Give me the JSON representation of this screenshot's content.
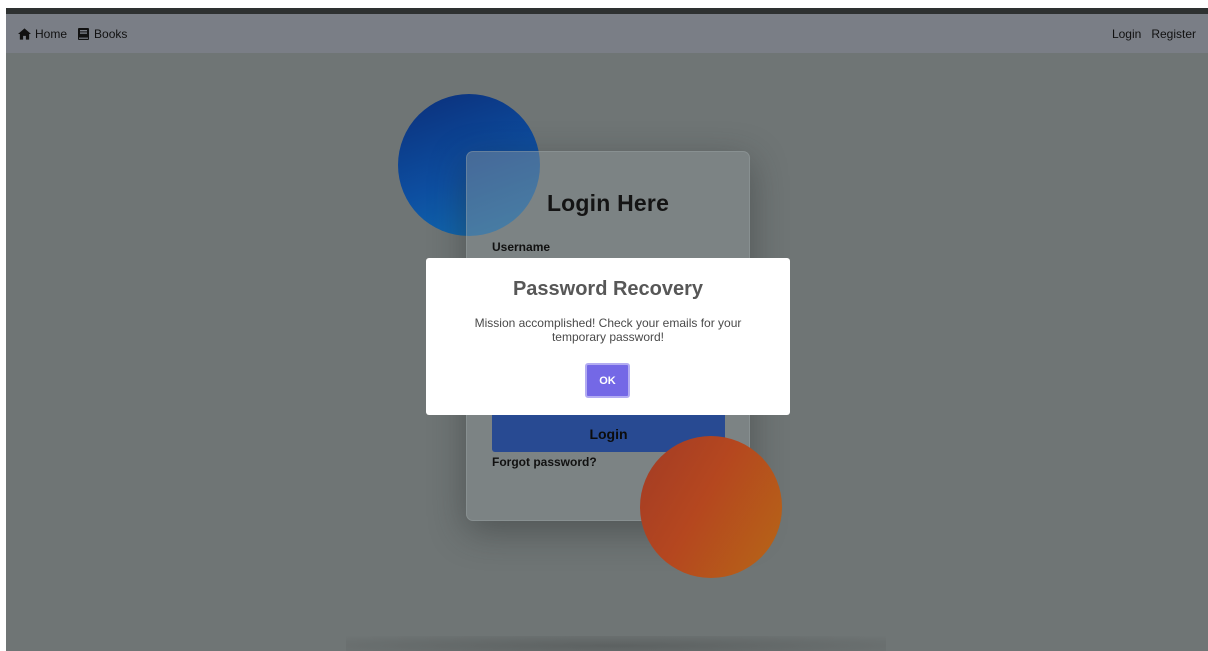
{
  "navbar": {
    "home_label": "Home",
    "books_label": "Books",
    "login_label": "Login",
    "register_label": "Register"
  },
  "login_form": {
    "title": "Login Here",
    "username_label": "Username",
    "login_button_label": "Login",
    "forgot_password_label": "Forgot password?"
  },
  "modal": {
    "title": "Password Recovery",
    "message": "Mission accomplished! Check your emails for your temporary password!",
    "ok_label": "OK"
  },
  "colors": {
    "overlay": "#6f7575",
    "navbar": "#7a7e86",
    "login_button": "#284a92",
    "ok_button": "#7468e6",
    "circle_blue": "#0d4ea0",
    "circle_orange": "#b5471f"
  },
  "icons": {
    "home": "home-icon",
    "books": "book-icon"
  }
}
